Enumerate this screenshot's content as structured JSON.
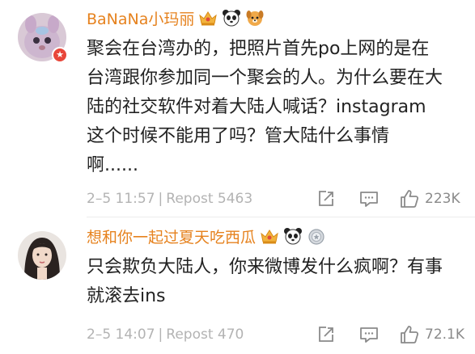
{
  "comments": [
    {
      "username": "BaNaNa小玛丽",
      "badges": [
        "crown-vip-icon",
        "panda-icon",
        "dog-icon"
      ],
      "lines": [
        "聚会在台湾办的，把照片首先po上网的是在",
        "台湾跟你参加同一个聚会的人。为什么要在大",
        "陆的社交软件对着大陆人喊话？instagram",
        "这个时候不能用了吗？管大陆什么事情",
        "啊......"
      ],
      "time": "2–5 11:57",
      "separator": "|",
      "repost_label": "Repost 5463",
      "likes": "223K"
    },
    {
      "username": "想和你一起过夏天吃西瓜",
      "badges": [
        "crown-vip-icon",
        "panda-icon",
        "silver-medal-icon"
      ],
      "lines": [
        "只会欺负大陆人，你来微博发什么疯啊？有事",
        "就滚去ins"
      ],
      "time": "2–5 14:07",
      "separator": "|",
      "repost_label": "Repost 470",
      "likes": "72.1K"
    }
  ],
  "colors": {
    "username": "#e6821e",
    "body_text": "#222222",
    "meta_text": "#b3b3b3",
    "icon": "#8a8a8a",
    "divider": "#ececec"
  }
}
